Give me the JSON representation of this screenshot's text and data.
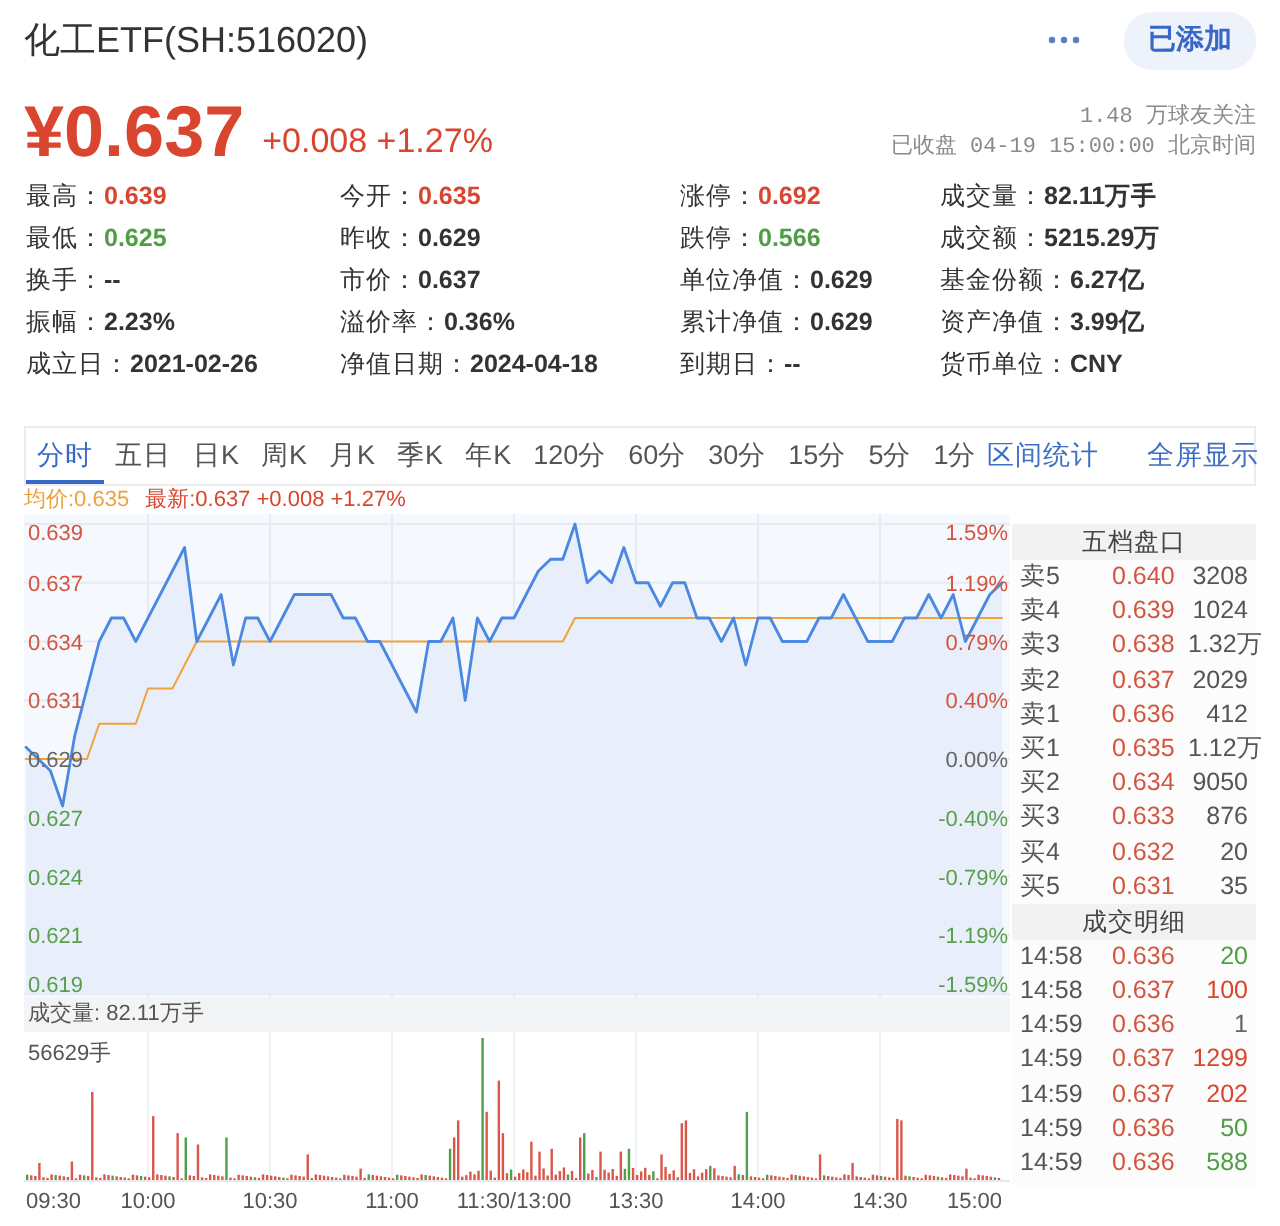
{
  "header": {
    "title": "化工ETF(SH:516020)",
    "follow_button": {
      "label": "已添加"
    }
  },
  "quote": {
    "price": "¥0.637",
    "change": "+0.008 +1.27%",
    "followers": "1.48 万球友关注",
    "status": "已收盘 04-19 15:00:00 北京时间"
  },
  "stats": [
    {
      "text": "最高：**0.639**",
      "color": "#d9452e"
    },
    {
      "text": "今开：**0.635**",
      "color": "#d9452e"
    },
    {
      "text": "涨停：**0.692**",
      "color": "#d9452e"
    },
    {
      "text": "成交量：**82.11万手**",
      "color": "#333333"
    },
    {
      "text": "最低：**0.625**",
      "color": "#4f9d45"
    },
    {
      "text": "昨收：**0.629**",
      "color": "#333333"
    },
    {
      "text": "跌停：**0.566**",
      "color": "#4f9d45"
    },
    {
      "text": "成交额：**5215.29万**",
      "color": "#333333"
    },
    {
      "text": "换手：**--**",
      "color": "#333333"
    },
    {
      "text": "市价：**0.637**",
      "color": "#333333"
    },
    {
      "text": "单位净值：**0.629**",
      "color": "#333333"
    },
    {
      "text": "基金份额：**6.27亿**",
      "color": "#333333"
    },
    {
      "text": "振幅：**2.23%**",
      "color": "#333333"
    },
    {
      "text": "溢价率：**0.36%**",
      "color": "#333333"
    },
    {
      "text": "累计净值：**0.629**",
      "color": "#333333"
    },
    {
      "text": "资产净值：**3.99亿**",
      "color": "#333333"
    },
    {
      "text": "成立日：**2021-02-26**",
      "color": "#333333"
    },
    {
      "text": "净值日期：**2024-04-18**",
      "color": "#333333"
    },
    {
      "text": "到期日：**--**",
      "color": "#333333"
    },
    {
      "text": "货币单位：**CNY**",
      "color": "#333333"
    }
  ],
  "tabs": [
    {
      "label": "分时",
      "selected": true
    },
    {
      "label": "五日",
      "selected": false
    },
    {
      "label": "日K",
      "selected": false
    },
    {
      "label": "周K",
      "selected": false
    },
    {
      "label": "月K",
      "selected": false
    },
    {
      "label": "季K",
      "selected": false
    },
    {
      "label": "年K",
      "selected": false
    },
    {
      "label": "120分",
      "selected": false
    },
    {
      "label": "60分",
      "selected": false
    },
    {
      "label": "30分",
      "selected": false
    },
    {
      "label": "15分",
      "selected": false
    },
    {
      "label": "5分",
      "selected": false
    },
    {
      "label": "1分",
      "selected": false
    }
  ],
  "tools": [
    "区间统计",
    "全屏显示"
  ],
  "price_chart": {
    "legend": [
      {
        "text": "均价:0.635",
        "color": "#eba23c"
      },
      {
        "text": "最新:0.637 +0.008 +1.27%",
        "color": "#d9452e"
      }
    ],
    "chart_data": {
      "type": "line",
      "grid": true,
      "ylim": [
        0.619,
        0.639
      ],
      "yticks": [
        {
          "value": 0.639,
          "label": "0.639"
        },
        {
          "value": 0.6365,
          "label": "0.637"
        },
        {
          "value": 0.634,
          "label": "0.634"
        },
        {
          "value": 0.6315,
          "label": "0.631"
        },
        {
          "value": 0.629,
          "label": "0.629"
        },
        {
          "value": 0.6265,
          "label": "0.627"
        },
        {
          "value": 0.624,
          "label": "0.624"
        },
        {
          "value": 0.6215,
          "label": "0.621"
        },
        {
          "value": 0.619,
          "label": "0.619"
        }
      ],
      "series": [
        {
          "color": "#f0a33a",
          "values": [
            0.629,
            0.629,
            0.629,
            0.629,
            0.629,
            0.629,
            0.6305,
            0.6305,
            0.6305,
            0.6305,
            0.632,
            0.632,
            0.632,
            0.633,
            0.634,
            0.634,
            0.634,
            0.634,
            0.634,
            0.634,
            0.634,
            0.634,
            0.634,
            0.634,
            0.634,
            0.634,
            0.634,
            0.634,
            0.634,
            0.634,
            0.634,
            0.634,
            0.634,
            0.634,
            0.634,
            0.634,
            0.634,
            0.634,
            0.634,
            0.634,
            0.634,
            0.634,
            0.634,
            0.634,
            0.634,
            0.635,
            0.635,
            0.635,
            0.635,
            0.635,
            0.635,
            0.635,
            0.635,
            0.635,
            0.635,
            0.635,
            0.635,
            0.635,
            0.635,
            0.635,
            0.635,
            0.635,
            0.635,
            0.635,
            0.635,
            0.635,
            0.635,
            0.635,
            0.635,
            0.635,
            0.635,
            0.635,
            0.635,
            0.635,
            0.635,
            0.635,
            0.635,
            0.635,
            0.635,
            0.635,
            0.635
          ]
        },
        {
          "color": "#4a88e2",
          "values": [
            0.6295,
            0.629,
            0.6285,
            0.627,
            0.63,
            0.632,
            0.634,
            0.635,
            0.635,
            0.634,
            0.635,
            0.636,
            0.637,
            0.638,
            0.634,
            0.635,
            0.636,
            0.633,
            0.635,
            0.635,
            0.634,
            0.635,
            0.636,
            0.636,
            0.636,
            0.636,
            0.635,
            0.635,
            0.634,
            0.634,
            0.633,
            0.632,
            0.631,
            0.634,
            0.634,
            0.635,
            0.6315,
            0.635,
            0.634,
            0.635,
            0.635,
            0.636,
            0.637,
            0.6375,
            0.6375,
            0.639,
            0.6365,
            0.637,
            0.6365,
            0.638,
            0.6365,
            0.6365,
            0.6355,
            0.6365,
            0.6365,
            0.635,
            0.635,
            0.634,
            0.635,
            0.633,
            0.635,
            0.635,
            0.634,
            0.634,
            0.634,
            0.635,
            0.635,
            0.636,
            0.635,
            0.634,
            0.634,
            0.634,
            0.635,
            0.635,
            0.636,
            0.635,
            0.636,
            0.634,
            0.635,
            0.636,
            0.6365
          ]
        }
      ]
    },
    "percent_labels": [
      {
        "text": "1.59%",
        "color": "#d4553f"
      },
      {
        "text": "1.19%",
        "color": "#d4553f"
      },
      {
        "text": "0.79%",
        "color": "#d4553f"
      },
      {
        "text": "0.40%",
        "color": "#d4553f"
      },
      {
        "text": "0.00%",
        "color": "#666666"
      },
      {
        "text": "-0.40%",
        "color": "#5a9f4c"
      },
      {
        "text": "-0.79%",
        "color": "#5a9f4c"
      },
      {
        "text": "-1.19%",
        "color": "#5a9f4c"
      },
      {
        "text": "-1.59%",
        "color": "#5a9f4c"
      }
    ]
  },
  "volume": {
    "title": "成交量: 82.11万手",
    "max_label": "56629手",
    "time_labels": [
      "09:30",
      "10:00",
      "10:30",
      "11:00",
      "11:30/13:00",
      "13:30",
      "14:00",
      "14:30",
      "15:00"
    ]
  },
  "order_book": {
    "title": "五档盘口",
    "levels": [
      {
        "label": "卖5",
        "price": "0.640",
        "volume": "3208"
      },
      {
        "label": "卖4",
        "price": "0.639",
        "volume": "1024"
      },
      {
        "label": "卖3",
        "price": "0.638",
        "volume": "1.32万"
      },
      {
        "label": "卖2",
        "price": "0.637",
        "volume": "2029"
      },
      {
        "label": "卖1",
        "price": "0.636",
        "volume": "412"
      },
      {
        "label": "买1",
        "price": "0.635",
        "volume": "1.12万"
      },
      {
        "label": "买2",
        "price": "0.634",
        "volume": "9050"
      },
      {
        "label": "买3",
        "price": "0.633",
        "volume": "876"
      },
      {
        "label": "买4",
        "price": "0.632",
        "volume": "20"
      },
      {
        "label": "买5",
        "price": "0.631",
        "volume": "35"
      }
    ]
  },
  "trades": {
    "title": "成交明细",
    "rows": [
      {
        "time": "14:58",
        "price": "0.636",
        "volume": "20",
        "color": "#4f9d45"
      },
      {
        "time": "14:58",
        "price": "0.637",
        "volume": "100",
        "color": "#d9452e"
      },
      {
        "time": "14:59",
        "price": "0.636",
        "volume": "1",
        "color": "#666666"
      },
      {
        "time": "14:59",
        "price": "0.637",
        "volume": "1299",
        "color": "#d9452e"
      },
      {
        "time": "14:59",
        "price": "0.637",
        "volume": "202",
        "color": "#d9452e"
      },
      {
        "time": "14:59",
        "price": "0.636",
        "volume": "50",
        "color": "#4f9d45"
      },
      {
        "time": "14:59",
        "price": "0.636",
        "volume": "588",
        "color": "#4f9d45"
      }
    ]
  }
}
